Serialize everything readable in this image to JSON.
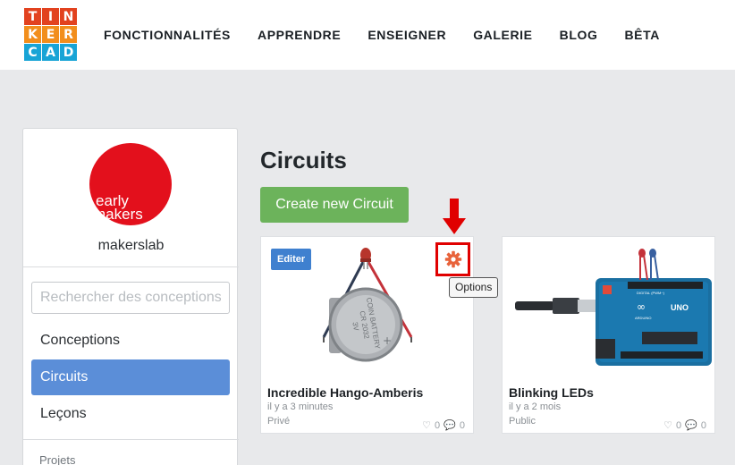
{
  "brand": {
    "logo_letters": [
      "T",
      "I",
      "N",
      "K",
      "E",
      "R",
      "C",
      "A",
      "D"
    ],
    "logo_colors": [
      "#e2421f",
      "#e2421f",
      "#e2421f",
      "#f28e1c",
      "#f28e1c",
      "#f28e1c",
      "#18a4d6",
      "#18a4d6",
      "#18a4d6"
    ]
  },
  "nav": {
    "items": [
      "FONCTIONNALITÉS",
      "APPRENDRE",
      "ENSEIGNER",
      "GALERIE",
      "BLOG",
      "BÊTA"
    ]
  },
  "sidebar": {
    "avatar": {
      "line1": "early",
      "line2": "makers",
      "color": "#e3101c"
    },
    "username": "makerslab",
    "search_placeholder": "Rechercher des conceptions",
    "items": [
      {
        "label": "Conceptions",
        "active": false
      },
      {
        "label": "Circuits",
        "active": true
      },
      {
        "label": "Leçons",
        "active": false
      }
    ],
    "section_label": "Projets"
  },
  "main": {
    "title": "Circuits",
    "create_button": "Create new Circuit",
    "create_button_color": "#6cb35b",
    "tooltip": "Options",
    "cards": [
      {
        "badge": "Editer",
        "name": "Incredible Hango-Amberis",
        "modified": "il y a 3 minutes",
        "visibility": "Privé",
        "likes": "0",
        "comments": "0",
        "battery_text": [
          "COIN BATTERY",
          "CR 2032",
          "3V"
        ]
      },
      {
        "name": "Blinking LEDs",
        "modified": "il y a 2 mois",
        "visibility": "Public",
        "likes": "0",
        "comments": "0",
        "board_text": [
          "UNO",
          "DIGITAL (PWM~)",
          "ARDUINO"
        ]
      }
    ]
  },
  "colors": {
    "accent_blue": "#5b8ed8",
    "highlight_red": "#e00000"
  }
}
